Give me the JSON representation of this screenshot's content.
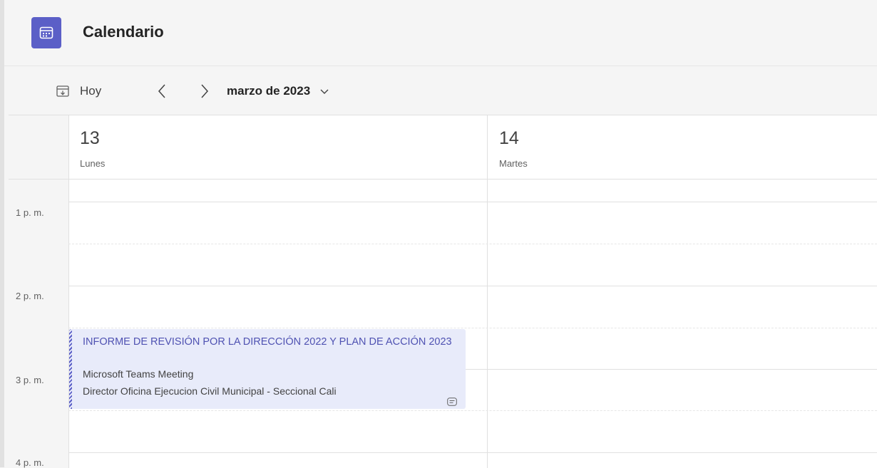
{
  "app": {
    "title": "Calendario",
    "icon": "calendar-icon",
    "accent": "#5b5fc7"
  },
  "toolbar": {
    "today_label": "Hoy",
    "today_icon": "calendar-today-icon",
    "prev_icon": "chevron-left-icon",
    "next_icon": "chevron-right-icon",
    "month_label": "marzo de 2023",
    "month_dropdown_icon": "chevron-down-icon"
  },
  "days": [
    {
      "number": "13",
      "name": "Lunes"
    },
    {
      "number": "14",
      "name": "Martes"
    }
  ],
  "time_labels": [
    "1 p. m.",
    "2 p. m.",
    "3 p. m.",
    "4 p. m."
  ],
  "event": {
    "title": "INFORME DE REVISIÓN POR LA DIRECCIÓN 2022 Y PLAN DE ACCIÓN 2023",
    "location": "Microsoft Teams Meeting",
    "organizer": "Director Oficina Ejecucion Civil Municipal - Seccional Cali",
    "chat_icon": "chat-icon",
    "background": "#e8ebfa",
    "title_color": "#4f52b2"
  }
}
